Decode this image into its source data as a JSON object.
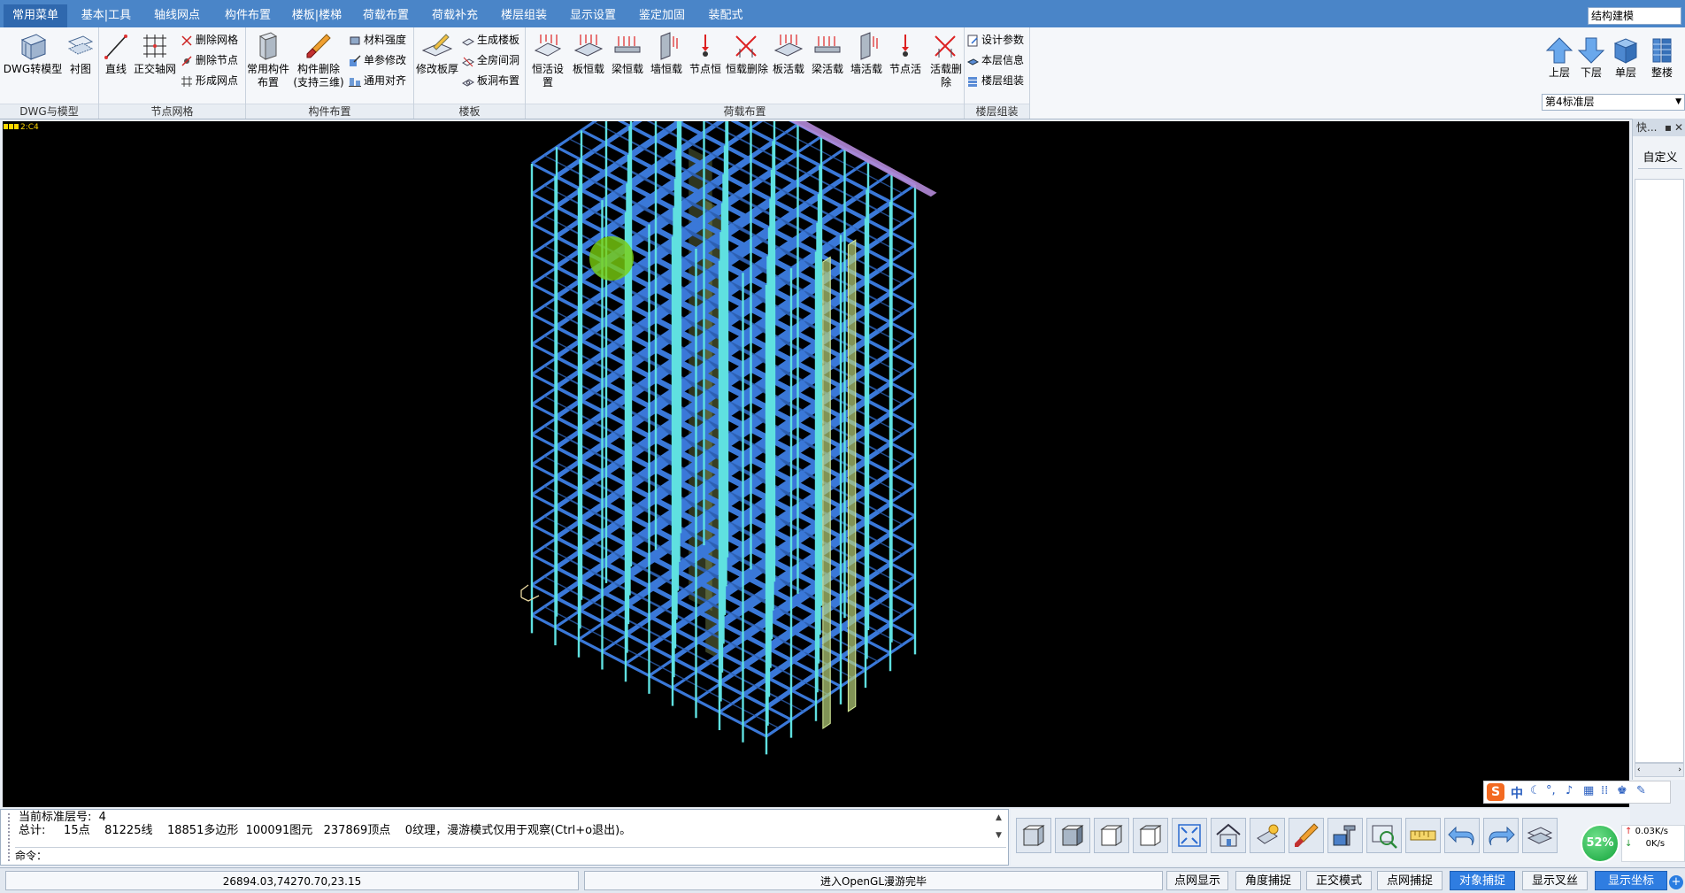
{
  "menu": {
    "tabs": [
      "常用菜单",
      "基本|工具",
      "轴线网点",
      "构件布置",
      "楼板|楼梯",
      "荷载布置",
      "荷载补充",
      "楼层组装",
      "显示设置",
      "鉴定加固",
      "装配式"
    ],
    "mode": "结构建模"
  },
  "ribbon": {
    "g1": {
      "label": "DWG与模型",
      "b1": "DWG转模型",
      "b2": "衬图"
    },
    "g2": {
      "label": "节点网格",
      "b1": "直线",
      "b2": "正交轴网",
      "s1": "删除网格",
      "s2": "删除节点",
      "s3": "形成网点"
    },
    "g3": {
      "label": "构件布置",
      "b1a": "常用构件",
      "b1b": "布置",
      "b2a": "构件删除",
      "b2b": "(支持三维)",
      "s1": "材料强度",
      "s2": "单参修改",
      "s3": "通用对齐"
    },
    "g4": {
      "label": "楼板",
      "b1": "修改板厚",
      "s1": "生成楼板",
      "s2": "全房间洞",
      "s3": "板洞布置"
    },
    "g5": {
      "label": "荷载布置",
      "items": [
        "恒活设置",
        "板恒载",
        "梁恒载",
        "墙恒载",
        "节点恒",
        "恒载删除",
        "板活载",
        "梁活载",
        "墙活载",
        "节点活",
        "活载删除"
      ]
    },
    "g6": {
      "label": "楼层组装",
      "s1": "设计参数",
      "s2": "本层信息",
      "s3": "楼层组装"
    },
    "floor_nav": [
      "上层",
      "下层",
      "单层",
      "整楼"
    ],
    "floor_select": "第4标准层"
  },
  "viewport": {
    "tag": "2:C4"
  },
  "side_panel": {
    "title": "快...",
    "custom": "自定义"
  },
  "command": {
    "line1": "当前标准层号:  4",
    "line2": "总计:     15点    81225线    18851多边形  100091图元   237869顶点    0纹理，漫游模式仅用于观察(Ctrl+o退出)。",
    "prompt": "命令："
  },
  "status": {
    "coords": "26894.03,74270.70,23.15",
    "message": "进入OpenGL漫游完毕",
    "buttons": [
      "点网显示",
      "角度捕捉",
      "正交模式",
      "点网捕捉",
      "对象捕捉",
      "显示叉丝",
      "显示坐标"
    ],
    "active": [
      "对象捕捉",
      "显示坐标"
    ]
  },
  "netmeter": {
    "percent": "52%",
    "up": "0.03K/s",
    "down": "0K/s"
  },
  "ime": {
    "label": "中"
  },
  "colors": {
    "menubar": "#4a85c8",
    "beam": "#3a78d8",
    "column": "#5fe0e0",
    "wall": "#b8d27a",
    "active": "#2f7de1"
  }
}
